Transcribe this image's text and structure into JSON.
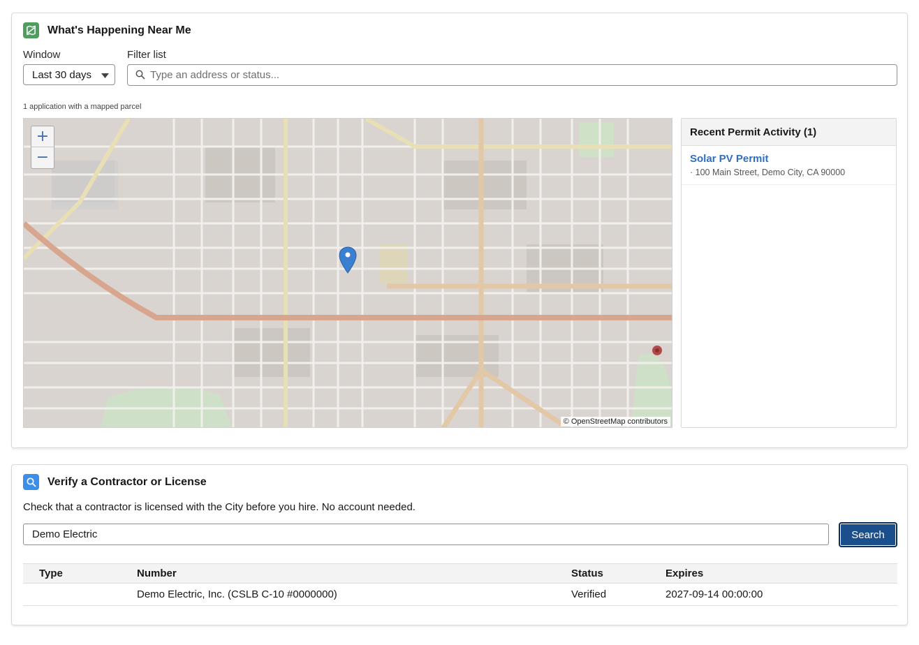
{
  "near_me": {
    "title": "What's Happening Near Me",
    "window_label": "Window",
    "window_value": "Last 30 days",
    "filter_label": "Filter list",
    "filter_placeholder": "Type an address or status...",
    "caption": "1 application with a mapped parcel",
    "map": {
      "zoom_in": "+",
      "zoom_out": "−",
      "attribution": "© OpenStreetMap contributors"
    },
    "activity": {
      "heading": "Recent Permit Activity (1)",
      "items": [
        {
          "title": "Solar PV Permit",
          "address": "· 100 Main Street, Demo City, CA 90000"
        }
      ]
    }
  },
  "verify": {
    "title": "Verify a Contractor or License",
    "description": "Check that a contractor is licensed with the City before you hire. No account needed.",
    "search_value": "Demo Electric",
    "search_button": "Search",
    "table": {
      "headers": [
        "Type",
        "Number",
        "Status",
        "Expires"
      ],
      "rows": [
        [
          "",
          "Demo Electric, Inc. (CSLB C-10 #0000000)",
          "Verified",
          "2027-09-14 00:00:00"
        ]
      ]
    }
  },
  "colors": {
    "brand_green": "#4f9e5d",
    "brand_blue": "#3d8ee8",
    "link": "#2f6fc0",
    "button": "#1b4f8c"
  },
  "icons": {
    "near_me": "map-icon",
    "verify": "search-icon",
    "filter": "search-icon",
    "select": "chevron-down-icon",
    "marker": "map-pin-icon"
  }
}
